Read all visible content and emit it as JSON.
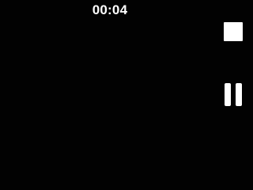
{
  "recording": {
    "elapsed_time": "00:04",
    "stop_icon": "stop-icon",
    "pause_icon": "pause-icon"
  },
  "colors": {
    "background": "#020202",
    "foreground": "#ffffff"
  }
}
